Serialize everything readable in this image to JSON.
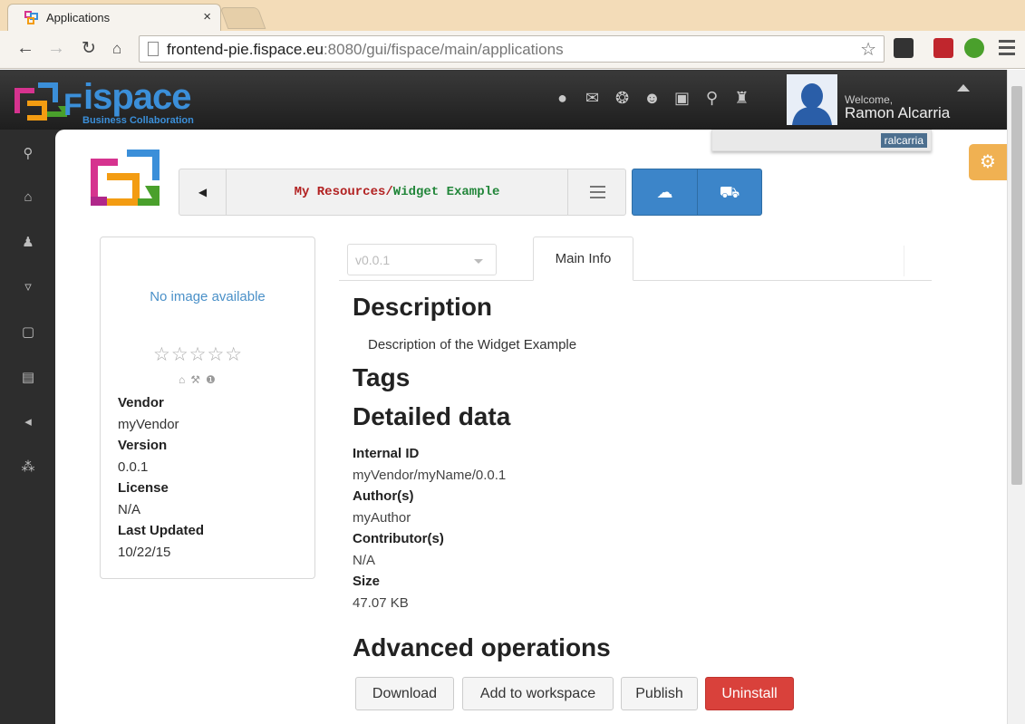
{
  "browser": {
    "tab_title": "Applications",
    "tab_close": "×",
    "url_host": "frontend-pie.fispace.eu",
    "url_rest": ":8080/gui/fispace/main/applications"
  },
  "header": {
    "brand_name": "ispace",
    "brand_sub": "Business Collaboration",
    "welcome": "Welcome,",
    "username": "Ramon Alcarria",
    "icons": [
      "globe-icon",
      "envelope-icon",
      "chat-icon",
      "group-icon",
      "briefcase-icon",
      "search-icon",
      "sitemap-icon"
    ]
  },
  "rail": {
    "items": [
      "search-icon",
      "home-icon",
      "user-icon",
      "cart-icon",
      "inbox-icon",
      "book-icon",
      "megaphone-icon",
      "cubes-icon"
    ]
  },
  "user_badge": "ralcarria",
  "path": {
    "segment1": "My Resources",
    "separator": "/",
    "segment2": "Widget Example"
  },
  "sidebar": {
    "no_image": "No image available",
    "stars": "☆☆☆☆☆",
    "rating": 0,
    "vendor_label": "Vendor",
    "vendor": "myVendor",
    "version_label": "Version",
    "version": "0.0.1",
    "license_label": "License",
    "license": "N/A",
    "updated_label": "Last Updated",
    "updated": "10/22/15"
  },
  "version_select": {
    "value": "v0.0.1"
  },
  "tabs": {
    "main_info": "Main Info"
  },
  "main": {
    "description_heading": "Description",
    "description": "Description of the Widget Example",
    "tags_heading": "Tags",
    "detailed_heading": "Detailed data",
    "internal_id_label": "Internal ID",
    "internal_id": "myVendor/myName/0.0.1",
    "authors_label": "Author(s)",
    "authors": "myAuthor",
    "contributors_label": "Contributor(s)",
    "contributors": "N/A",
    "size_label": "Size",
    "size": "47.07 KB",
    "advanced_heading": "Advanced operations"
  },
  "actions": {
    "download": "Download",
    "add_to_workspace": "Add to workspace",
    "publish": "Publish",
    "uninstall": "Uninstall"
  },
  "colors": {
    "brand_blue": "#3b8fd9",
    "primary": "#3c85c9",
    "danger": "#d9413b",
    "settings_orange": "#f0b152"
  }
}
